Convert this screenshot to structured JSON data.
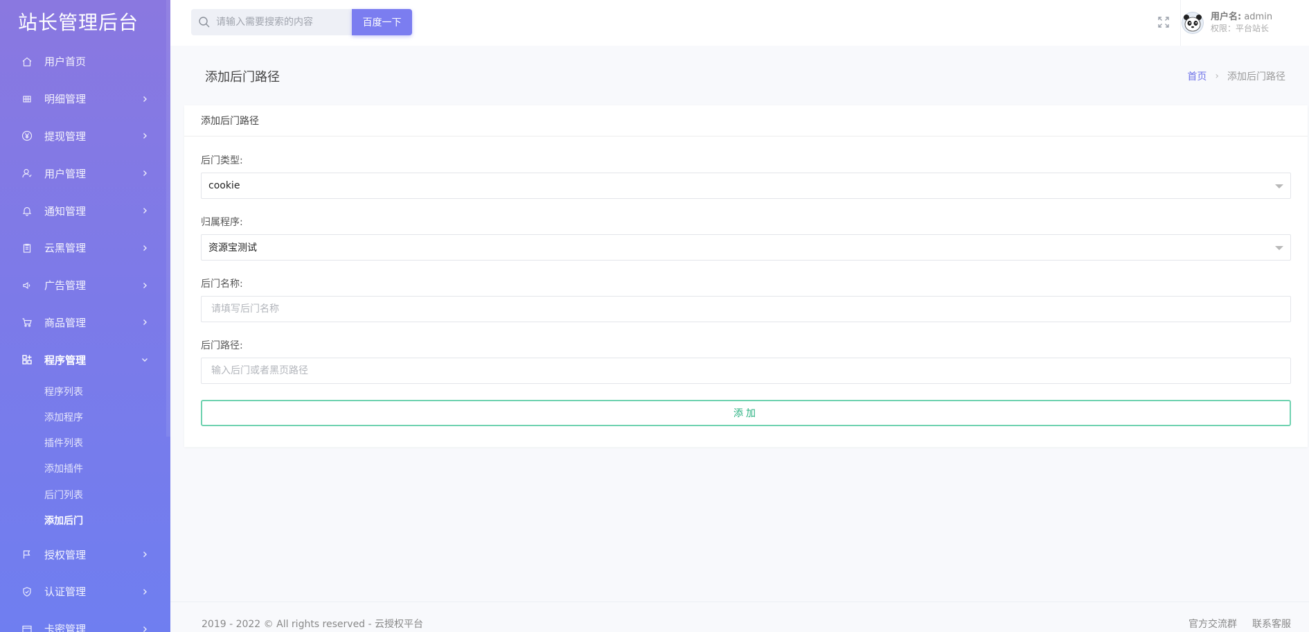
{
  "brand": "站长管理后台",
  "colors": {
    "sidebar_top": "#8a78e0",
    "sidebar_bottom": "#6f7ef0",
    "accent": "#7b7df0",
    "submit_border": "#6fd2b0",
    "submit_text": "#27b07f"
  },
  "sidebar": {
    "items": [
      {
        "label": "用户首页",
        "icon": "home-icon",
        "has_children": false
      },
      {
        "label": "明细管理",
        "icon": "table-icon",
        "has_children": true
      },
      {
        "label": "提现管理",
        "icon": "yen-icon",
        "has_children": true
      },
      {
        "label": "用户管理",
        "icon": "user-icon",
        "has_children": true
      },
      {
        "label": "通知管理",
        "icon": "bell-icon",
        "has_children": true
      },
      {
        "label": "云黑管理",
        "icon": "clipboard-icon",
        "has_children": true
      },
      {
        "label": "广告管理",
        "icon": "speaker-icon",
        "has_children": true
      },
      {
        "label": "商品管理",
        "icon": "cart-icon",
        "has_children": true
      },
      {
        "label": "程序管理",
        "icon": "apps-icon",
        "has_children": true,
        "expanded": true
      }
    ],
    "sub_items": [
      "程序列表",
      "添加程序",
      "插件列表",
      "添加插件",
      "后门列表",
      "添加后门"
    ],
    "active_sub": "添加后门",
    "items_after": [
      {
        "label": "授权管理",
        "icon": "flag-icon"
      },
      {
        "label": "认证管理",
        "icon": "shield-check-icon"
      },
      {
        "label": "卡密管理",
        "icon": "card-icon"
      }
    ]
  },
  "search": {
    "placeholder": "请输入需要搜索的内容",
    "button_label": "百度一下"
  },
  "user": {
    "name_label": "用户名:",
    "name": "admin",
    "role": "权限：平台站长"
  },
  "page": {
    "title": "添加后门路径",
    "breadcrumb_home": "首页",
    "breadcrumb_sep": "›",
    "breadcrumb_current": "添加后门路径"
  },
  "form": {
    "card_title": "添加后门路径",
    "type_label": "后门类型:",
    "type_value": "cookie",
    "program_label": "归属程序:",
    "program_value": "资源宝测试",
    "name_label": "后门名称:",
    "name_placeholder": "请填写后门名称",
    "path_label": "后门路径:",
    "path_placeholder": "输入后门或者黑页路径",
    "submit_label": "添加"
  },
  "footer": {
    "copyright": "2019 - 2022 © All rights reserved - 云授权平台",
    "link_group": "官方交流群",
    "link_service": "联系客服"
  }
}
